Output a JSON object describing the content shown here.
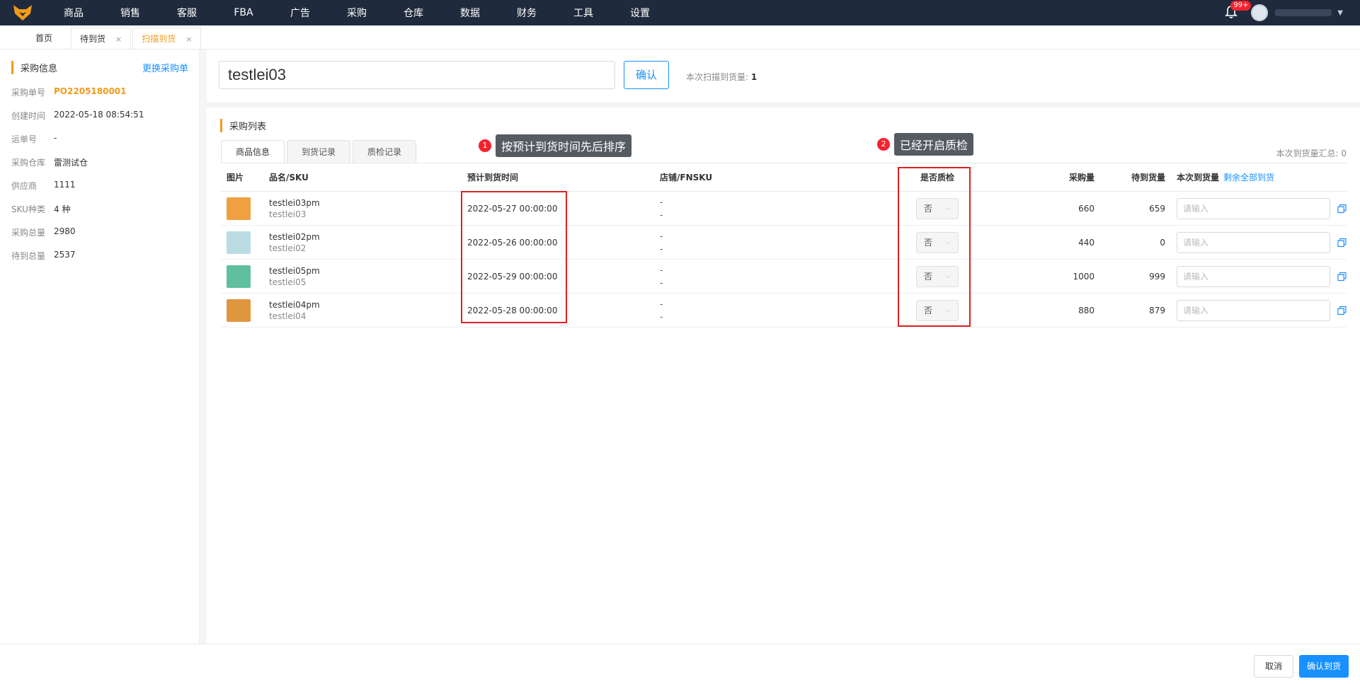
{
  "nav": {
    "items": [
      "商品",
      "销售",
      "客服",
      "FBA",
      "广告",
      "采购",
      "仓库",
      "数据",
      "财务",
      "工具",
      "设置"
    ],
    "badge": "99+"
  },
  "tabs": {
    "home": "首页",
    "pending": "待到货",
    "scan": "扫描到货"
  },
  "left": {
    "title": "采购信息",
    "change_link": "更换采购单",
    "rows": [
      {
        "label": "采购单号",
        "value": "PO2205180001"
      },
      {
        "label": "创建时间",
        "value": "2022-05-18 08:54:51"
      },
      {
        "label": "运单号",
        "value": "-"
      },
      {
        "label": "采购仓库",
        "value": "雷测试仓"
      },
      {
        "label": "供应商",
        "value": "1111"
      },
      {
        "label": "SKU种类",
        "value": "4 种"
      },
      {
        "label": "采购总量",
        "value": "2980"
      },
      {
        "label": "待到总量",
        "value": "2537"
      }
    ]
  },
  "scan": {
    "input_value": "testlei03",
    "confirm": "确认",
    "count_label": "本次扫描到货量:",
    "count_value": "1"
  },
  "list": {
    "title": "采购列表",
    "tabs": [
      "商品信息",
      "到货记录",
      "质检记录"
    ],
    "summary": "本次到货量汇总: 0",
    "headers": {
      "img": "图片",
      "name": "品名/SKU",
      "date": "预计到货时间",
      "shop": "店铺/FNSKU",
      "qc": "是否质检",
      "qty": "采购量",
      "pending": "待到货量",
      "now": "本次到货量",
      "all_link": "剩余全部到货"
    },
    "rows": [
      {
        "name": "testlei03pm",
        "sku": "testlei03",
        "date": "2022-05-27 00:00:00",
        "shop": "-",
        "fnsku": "-",
        "qc": "否",
        "qty": "660",
        "pending": "659",
        "placeholder": "请输入",
        "color": "#f0a040"
      },
      {
        "name": "testlei02pm",
        "sku": "testlei02",
        "date": "2022-05-26 00:00:00",
        "shop": "-",
        "fnsku": "-",
        "qc": "否",
        "qty": "440",
        "pending": "0",
        "placeholder": "请输入",
        "color": "#b9dde3"
      },
      {
        "name": "testlei05pm",
        "sku": "testlei05",
        "date": "2022-05-29 00:00:00",
        "shop": "-",
        "fnsku": "-",
        "qc": "否",
        "qty": "1000",
        "pending": "999",
        "placeholder": "请输入",
        "color": "#5fbfa0"
      },
      {
        "name": "testlei04pm",
        "sku": "testlei04",
        "date": "2022-05-28 00:00:00",
        "shop": "-",
        "fnsku": "-",
        "qc": "否",
        "qty": "880",
        "pending": "879",
        "placeholder": "请输入",
        "color": "#e0963f"
      }
    ]
  },
  "annotations": [
    {
      "num": "1",
      "text": "按预计到货时间先后排序"
    },
    {
      "num": "2",
      "text": "已经开启质检"
    }
  ],
  "footer": {
    "cancel": "取消",
    "ok": "确认到货"
  },
  "colors": {
    "accent": "#f29b1a",
    "primary": "#1890ff",
    "nav_bg": "#1f2a3d",
    "highlight": "#e02020"
  }
}
